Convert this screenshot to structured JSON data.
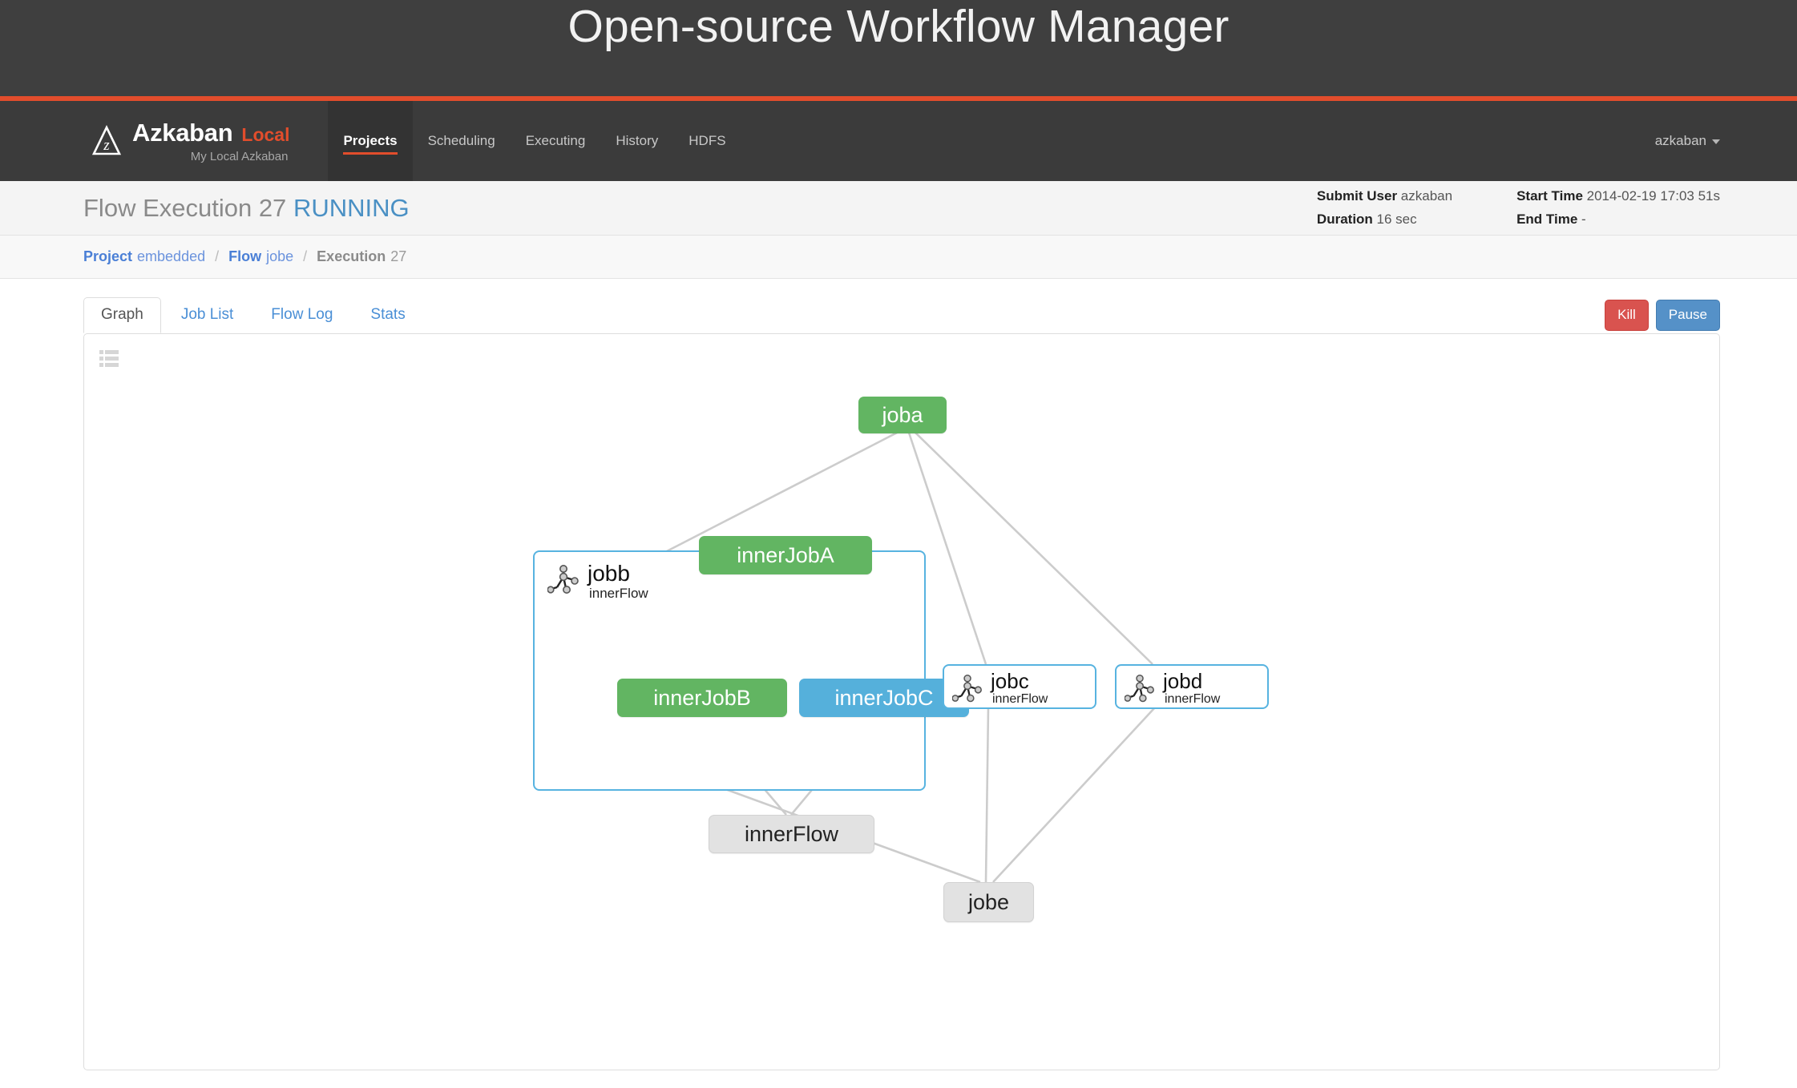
{
  "banner": {
    "title": "Open-source Workflow Manager"
  },
  "navbar": {
    "brand_name": "Azkaban",
    "brand_local": "Local",
    "brand_sub": "My Local Azkaban",
    "items": [
      {
        "label": "Projects",
        "active": true
      },
      {
        "label": "Scheduling",
        "active": false
      },
      {
        "label": "Executing",
        "active": false
      },
      {
        "label": "History",
        "active": false
      },
      {
        "label": "HDFS",
        "active": false
      }
    ],
    "user": "azkaban",
    "accent_color": "#e24d2c"
  },
  "page_header": {
    "title_prefix": "Flow Execution 27",
    "status": "RUNNING",
    "status_color": "#4a90c4",
    "meta": {
      "submit_user_label": "Submit User",
      "submit_user_value": "azkaban",
      "duration_label": "Duration",
      "duration_value": "16 sec",
      "start_time_label": "Start Time",
      "start_time_value": "2014-02-19 17:03 51s",
      "end_time_label": "End Time",
      "end_time_value": "-"
    }
  },
  "breadcrumb": {
    "project_label": "Project",
    "project_value": "embedded",
    "flow_label": "Flow",
    "flow_value": "jobe",
    "execution_label": "Execution",
    "execution_value": "27",
    "separator": "/"
  },
  "tabs": [
    {
      "label": "Graph",
      "active": true
    },
    {
      "label": "Job List",
      "active": false
    },
    {
      "label": "Flow Log",
      "active": false
    },
    {
      "label": "Stats",
      "active": false
    }
  ],
  "actions": {
    "kill_label": "Kill",
    "pause_label": "Pause",
    "kill_color": "#d9534f",
    "pause_color": "#5591c8"
  },
  "graph": {
    "toolbar_icon": "list-icon",
    "nodes": {
      "joba": {
        "label": "joba",
        "status": "running",
        "color": "#62b562"
      },
      "jobb": {
        "label": "jobb",
        "sublabel": "innerFlow",
        "type": "flow"
      },
      "jobc": {
        "label": "jobc",
        "sublabel": "innerFlow",
        "type": "flow"
      },
      "jobd": {
        "label": "jobd",
        "sublabel": "innerFlow",
        "type": "flow"
      },
      "jobe": {
        "label": "jobe",
        "status": "ready",
        "color": "#e2e2e2"
      },
      "innerJobA": {
        "label": "innerJobA",
        "status": "running",
        "color": "#62b562"
      },
      "innerJobB": {
        "label": "innerJobB",
        "status": "running",
        "color": "#62b562"
      },
      "innerJobC": {
        "label": "innerJobC",
        "status": "queued",
        "color": "#55b0db"
      },
      "innerFlow": {
        "label": "innerFlow",
        "status": "ready",
        "color": "#e2e2e2"
      }
    },
    "edges": [
      {
        "from": "joba",
        "to": "jobb"
      },
      {
        "from": "joba",
        "to": "jobc"
      },
      {
        "from": "joba",
        "to": "jobd"
      },
      {
        "from": "jobb",
        "to": "jobe"
      },
      {
        "from": "jobc",
        "to": "jobe"
      },
      {
        "from": "jobd",
        "to": "jobe"
      },
      {
        "from": "innerJobA",
        "to": "innerJobB"
      },
      {
        "from": "innerJobA",
        "to": "innerJobC"
      },
      {
        "from": "innerJobB",
        "to": "innerFlow"
      },
      {
        "from": "innerJobC",
        "to": "innerFlow"
      }
    ]
  }
}
